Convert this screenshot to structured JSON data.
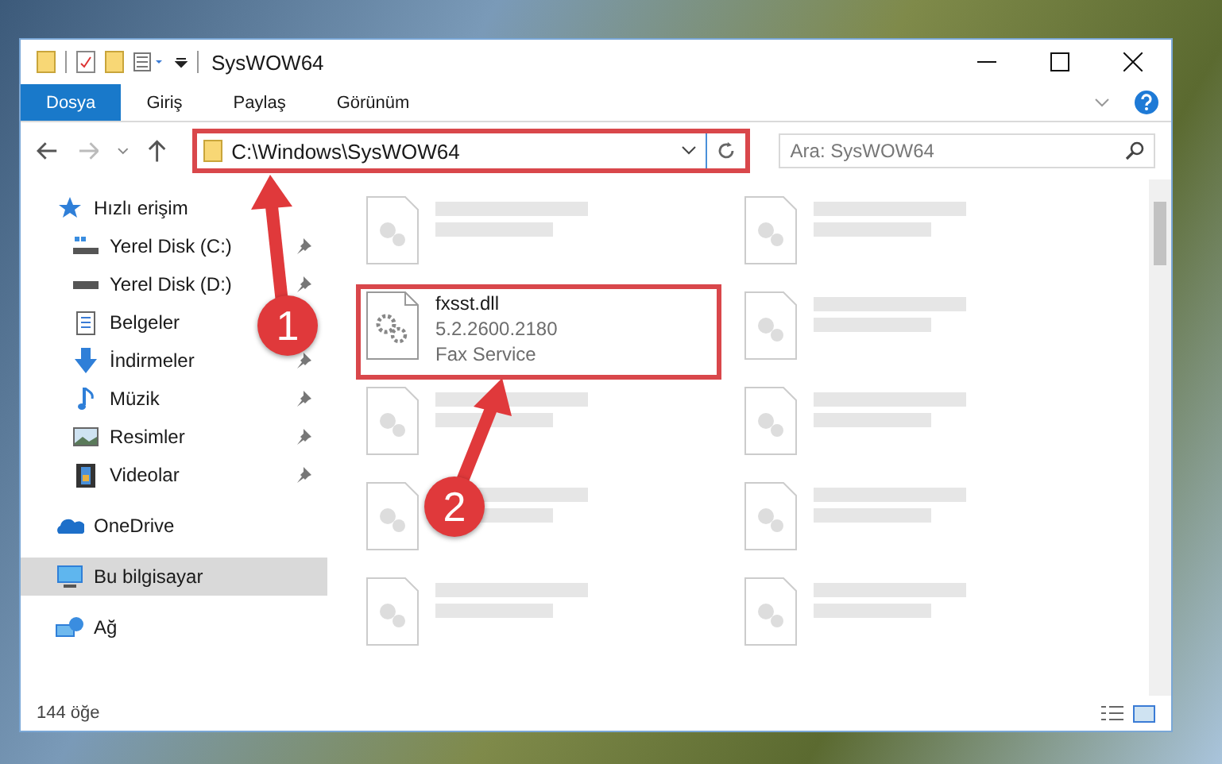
{
  "window": {
    "title": "SysWOW64"
  },
  "ribbon_tabs": [
    {
      "label": "Dosya",
      "selected": true
    },
    {
      "label": "Giriş",
      "selected": false
    },
    {
      "label": "Paylaş",
      "selected": false
    },
    {
      "label": "Görünüm",
      "selected": false
    }
  ],
  "address_bar": {
    "path": "C:\\Windows\\SysWOW64"
  },
  "search": {
    "placeholder": "Ara: SysWOW64"
  },
  "nav": {
    "items": [
      {
        "label": "Hızlı erişim",
        "kind": "star",
        "selected": false,
        "children": [
          {
            "label": "Yerel Disk (C:)",
            "kind": "drive-c",
            "pinned": true
          },
          {
            "label": "Yerel Disk (D:)",
            "kind": "drive",
            "pinned": true
          },
          {
            "label": "Belgeler",
            "kind": "documents"
          },
          {
            "label": "İndirmeler",
            "kind": "downloads",
            "pinned": true
          },
          {
            "label": "Müzik",
            "kind": "music",
            "pinned": true
          },
          {
            "label": "Resimler",
            "kind": "pictures",
            "pinned": true
          },
          {
            "label": "Videolar",
            "kind": "videos",
            "pinned": true
          }
        ]
      },
      {
        "label": "OneDrive",
        "kind": "cloud",
        "selected": false
      },
      {
        "label": "Bu bilgisayar",
        "kind": "computer",
        "selected": true
      },
      {
        "label": "Ağ",
        "kind": "network",
        "selected": false
      }
    ]
  },
  "files": [
    {
      "kind": "blurred"
    },
    {
      "kind": "blurred"
    },
    {
      "kind": "detailed",
      "name": "fxsst.dll",
      "lines": [
        "5.2.2600.2180",
        "Fax Service"
      ],
      "highlighted": true
    },
    {
      "kind": "blurred"
    },
    {
      "kind": "blurred"
    },
    {
      "kind": "blurred"
    },
    {
      "kind": "blurred"
    },
    {
      "kind": "blurred"
    },
    {
      "kind": "blurred"
    },
    {
      "kind": "blurred"
    }
  ],
  "status_bar": {
    "count": "144 öğe"
  },
  "callouts": [
    {
      "label": "1"
    },
    {
      "label": "2"
    }
  ]
}
